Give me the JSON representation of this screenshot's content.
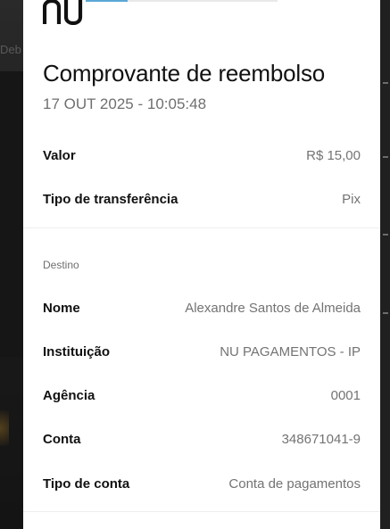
{
  "receipt": {
    "title": "Comprovante de reembolso",
    "datetime": "17 OUT 2025 - 10:05:48",
    "progress_fraction": 0.22,
    "summary": [
      {
        "label": "Valor",
        "value": "R$ 15,00"
      },
      {
        "label": "Tipo de transferência",
        "value": "Pix"
      }
    ],
    "destination": {
      "section_label": "Destino",
      "fields": [
        {
          "label": "Nome",
          "value": "Alexandre Santos de Almeida"
        },
        {
          "label": "Instituição",
          "value": "NU PAGAMENTOS - IP"
        },
        {
          "label": "Agência",
          "value": "0001"
        },
        {
          "label": "Conta",
          "value": "348671041-9"
        },
        {
          "label": "Tipo de conta",
          "value": "Conta de pagamentos"
        }
      ]
    }
  },
  "brand": {
    "logo_text": "nu",
    "logo_color": "#111111",
    "accent": "#5aa7d6"
  },
  "background": {
    "partial_text": "Deb"
  }
}
